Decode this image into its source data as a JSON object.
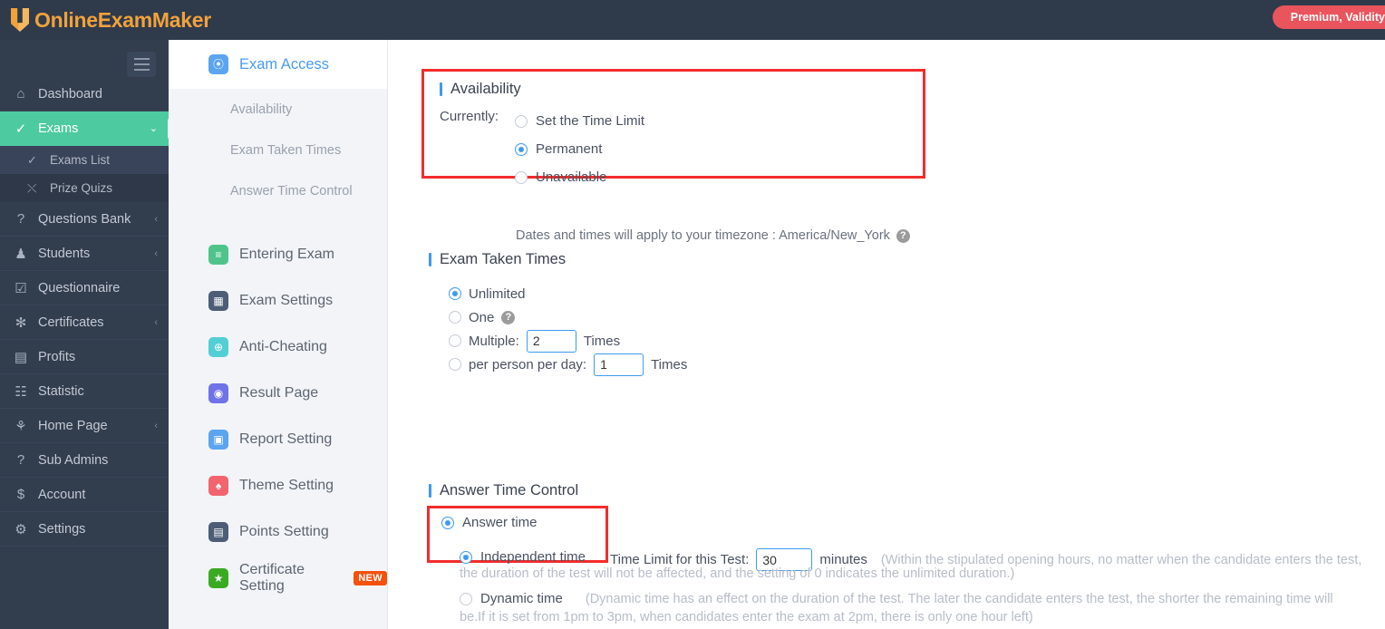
{
  "topbar": {
    "brand": "OnlineExamMaker",
    "premium_badge": "Premium, Validity"
  },
  "sidebar": {
    "items": [
      {
        "label": "Dashboard",
        "icon": "home-icon",
        "glyph": "⌂",
        "caret": "",
        "active": false
      },
      {
        "label": "Exams",
        "icon": "check-circle-icon",
        "glyph": "✓",
        "caret": "⌄",
        "active": true
      },
      {
        "label": "Questions Bank",
        "icon": "question-circle-icon",
        "glyph": "?",
        "caret": "‹",
        "active": false
      },
      {
        "label": "Students",
        "icon": "user-icon",
        "glyph": "♟",
        "caret": "‹",
        "active": false
      },
      {
        "label": "Questionnaire",
        "icon": "checkbox-icon",
        "glyph": "☑",
        "caret": "",
        "active": false
      },
      {
        "label": "Certificates",
        "icon": "badge-icon",
        "glyph": "✻",
        "caret": "‹",
        "active": false
      },
      {
        "label": "Profits",
        "icon": "card-icon",
        "glyph": "▤",
        "caret": "",
        "active": false
      },
      {
        "label": "Statistic",
        "icon": "bar-chart-icon",
        "glyph": "☷",
        "caret": "",
        "active": false
      },
      {
        "label": "Home Page",
        "icon": "plant-icon",
        "glyph": "⚘",
        "caret": "‹",
        "active": false
      },
      {
        "label": "Sub Admins",
        "icon": "question-circle-icon",
        "glyph": "?",
        "caret": "",
        "active": false
      },
      {
        "label": "Account",
        "icon": "dollar-icon",
        "glyph": "$",
        "caret": "",
        "active": false
      },
      {
        "label": "Settings",
        "icon": "gear-icon",
        "glyph": "⚙",
        "caret": "",
        "active": false
      }
    ],
    "sub_items": [
      {
        "label": "Exams List",
        "icon": "check-circle-icon",
        "glyph": "✓",
        "current": true
      },
      {
        "label": "Prize Quizs",
        "icon": "shuffle-icon",
        "glyph": "⤬",
        "current": false
      }
    ]
  },
  "panel": {
    "header": {
      "label": "Exam Access",
      "icon": "shield-icon",
      "glyph": "★",
      "color": "#5ba4f0"
    },
    "sub_links": [
      {
        "label": "Availability"
      },
      {
        "label": "Exam Taken Times"
      },
      {
        "label": "Answer Time Control"
      }
    ],
    "items": [
      {
        "label": "Entering Exam",
        "icon": "document-icon",
        "glyph": "≡",
        "color": "#4fc48a",
        "badge": ""
      },
      {
        "label": "Exam Settings",
        "icon": "grid-icon",
        "glyph": "▦",
        "color": "#4c5d75",
        "badge": ""
      },
      {
        "label": "Anti-Cheating",
        "icon": "shield-icon",
        "glyph": "⊕",
        "color": "#52cfd4",
        "badge": ""
      },
      {
        "label": "Result Page",
        "icon": "eye-icon",
        "glyph": "◉",
        "color": "#6f72e8",
        "badge": ""
      },
      {
        "label": "Report Setting",
        "icon": "report-icon",
        "glyph": "▣",
        "color": "#5ba4f0",
        "badge": ""
      },
      {
        "label": "Theme Setting",
        "icon": "tshirt-icon",
        "glyph": "♠",
        "color": "#f2646e",
        "badge": ""
      },
      {
        "label": "Points Setting",
        "icon": "calendar-icon",
        "glyph": "▤",
        "color": "#4c5d75",
        "badge": ""
      },
      {
        "label": "Certificate Setting",
        "icon": "medal-icon",
        "glyph": "★",
        "color": "#3aaa22",
        "badge": "NEW"
      }
    ]
  },
  "availability": {
    "title": "Availability",
    "currently_label": "Currently:",
    "options": [
      {
        "label": "Set the Time Limit",
        "selected": false
      },
      {
        "label": "Permanent",
        "selected": true
      },
      {
        "label": "Unavailable",
        "selected": false
      }
    ],
    "timezone_note": "Dates and times will apply to your timezone : America/New_York",
    "help_glyph": "?"
  },
  "exam_taken_times": {
    "title": "Exam Taken Times",
    "options": [
      {
        "label": "Unlimited",
        "selected": true,
        "help": false,
        "input": null,
        "suffix": ""
      },
      {
        "label": "One",
        "selected": false,
        "help": true,
        "input": null,
        "suffix": ""
      },
      {
        "label": "Multiple:",
        "selected": false,
        "help": false,
        "input": "2",
        "suffix": "Times"
      },
      {
        "label": "per person per day:",
        "selected": false,
        "help": false,
        "input": "1",
        "suffix": "Times"
      }
    ]
  },
  "answer_time_control": {
    "title": "Answer Time Control",
    "answer_time_label": "Answer time",
    "answer_time_selected": true,
    "independent_time_label": "Independent time",
    "independent_time_selected": true,
    "time_limit_label": "Time Limit for this Test:",
    "time_limit_value": "30",
    "minutes_label": "minutes",
    "independent_note_line1": "(Within the stipulated opening hours, no matter when the candidate enters the test,",
    "independent_note_line2": "the duration of the test will not be affected, and the setting of 0 indicates the unlimited duration.)",
    "dynamic_time_label": "Dynamic time",
    "dynamic_time_selected": false,
    "dynamic_note_line1": "(Dynamic time has an effect on the duration of the test. The later the candidate enters the test, the shorter the remaining time will",
    "dynamic_note_line2": "be.If it is set from 1pm to 3pm, when candidates enter the exam at 2pm, there is only one hour left)"
  },
  "colors": {
    "topbar": "#2f3a4b",
    "sidebar": "#323d4e",
    "active_green": "#4ecaa0",
    "accent_blue": "#3d9bf0",
    "highlight_red": "#f32c2c",
    "brand_orange": "#f0a23c",
    "premium_red": "#e9545d"
  }
}
